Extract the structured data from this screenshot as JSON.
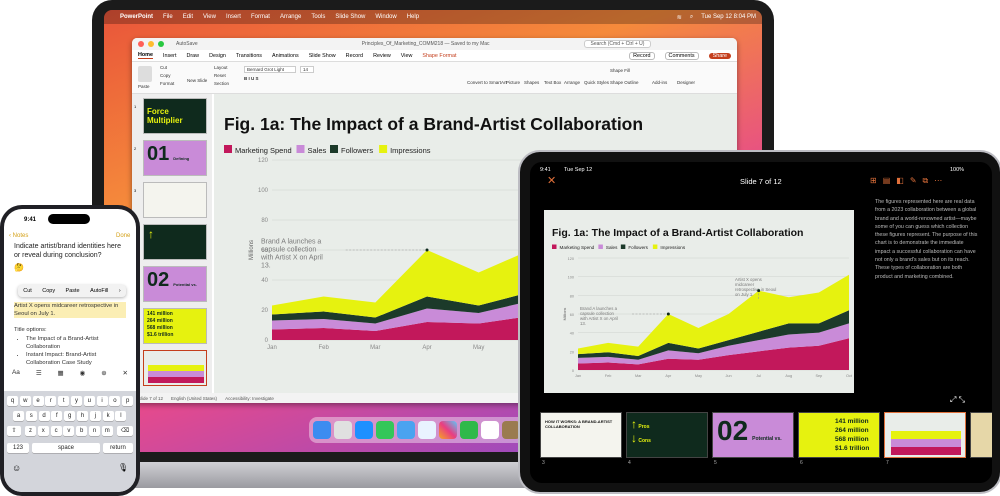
{
  "mac": {
    "menubar": {
      "apple": "",
      "app": "PowerPoint",
      "items": [
        "File",
        "Edit",
        "View",
        "Insert",
        "Format",
        "Arrange",
        "Tools",
        "Slide Show",
        "Window",
        "Help"
      ],
      "clock": "Tue Sep 12  8:04 PM"
    },
    "ppt": {
      "autosave": "AutoSave",
      "doc_title": "Principles_Of_Marketing_COMM218 — Saved to my Mac",
      "search": "Search (Cmd + Ctrl + U)",
      "tabs": [
        "Home",
        "Insert",
        "Draw",
        "Design",
        "Transitions",
        "Animations",
        "Slide Show",
        "Record",
        "Review",
        "View",
        "Shape Format"
      ],
      "record_btn": "Record",
      "comments_btn": "Comments",
      "share_btn": "Share",
      "ribbon": {
        "clip": [
          "Cut",
          "Copy",
          "Format"
        ],
        "paste": "Paste",
        "new_slide": "New Slide",
        "layout": "Layout",
        "reset": "Reset",
        "section": "Section",
        "font": "Bernard Grot Light",
        "size": "14",
        "convert": "Convert to SmartArt",
        "picture": "Picture",
        "shapes": "Shapes",
        "textbox": "Text Box",
        "arrange": "Arrange",
        "quick_styles": "Quick Styles",
        "shape_fill": "Shape Fill",
        "shape_outline": "Shape Outline",
        "addins": "Add-ins",
        "designer": "Designer"
      },
      "thumb_numbers": [
        "1",
        "2",
        "3",
        "4",
        "5",
        "6",
        "7"
      ],
      "thumbs": {
        "force": "Force Multiplier",
        "n01": "01",
        "n01_label": "Defining Collaboration",
        "n02": "02",
        "n02_label": "Potential vs. Impact",
        "stats": [
          "141 million",
          "264 million",
          "568 million",
          "$1.6 trillion"
        ]
      },
      "status": {
        "slide": "Slide 7 of 12",
        "lang": "English (United States)",
        "access": "Accessibility: Investigate"
      }
    }
  },
  "chart_data": {
    "type": "area",
    "title": "Fig. 1a: The Impact of a Brand-Artist Collaboration",
    "ylabel": "Millions",
    "xlabel": "",
    "categories": [
      "Jan",
      "Feb",
      "Mar",
      "Apr",
      "May",
      "Jun",
      "Jul",
      "Aug",
      "Sep",
      "Oct"
    ],
    "ylim": [
      0,
      120
    ],
    "yticks": [
      0,
      20,
      40,
      60,
      80,
      100,
      120
    ],
    "stacked": true,
    "series": [
      {
        "name": "Marketing Spend",
        "color": "#c2185b",
        "values": [
          7,
          8,
          6,
          12,
          11,
          16,
          20,
          24,
          26,
          34
        ]
      },
      {
        "name": "Sales",
        "color": "#c98bd8",
        "values": [
          6,
          6,
          5,
          9,
          7,
          10,
          12,
          14,
          14,
          16
        ]
      },
      {
        "name": "Followers",
        "color": "#1c3a2a",
        "values": [
          4,
          5,
          4,
          8,
          5,
          6,
          9,
          12,
          10,
          14
        ]
      },
      {
        "name": "Impressions",
        "color": "#e6f20f",
        "values": [
          6,
          10,
          10,
          31,
          22,
          28,
          44,
          28,
          33,
          38
        ]
      }
    ],
    "annotations": [
      {
        "text": "Brand A launches a capsule collection with Artist X on April 13.",
        "x": "Apr"
      },
      {
        "text": "Artist X opens midcareer retrospective in Seoul on July 1.",
        "x": "Jul"
      }
    ]
  },
  "ipad": {
    "clock": "9:41",
    "date": "Tue Sep 12",
    "title": "Slide 7 of 12",
    "battery": "100%",
    "notes": "The figures represented here are real data from a 2023 collaboration between a global brand and a world-renowned artist—maybe some of you can guess which collection these figures represent. The purpose of this chart is to demonstrate the immediate impact a successful collaboration can have not only a brand's sales but on its reach. These types of collaboration are both product and marketing combined.",
    "strip_numbers": [
      "3",
      "4",
      "5",
      "6",
      "7"
    ],
    "strip_headline": "HOW IT WORKS: A BRAND-ARTIST COLLABORATION",
    "strip_labels": [
      "Pros",
      "Cons"
    ]
  },
  "iphone": {
    "clock": "9:41",
    "back": "Notes",
    "done": "Done",
    "question": "Indicate artist/brand identities here or reveal during conclusion?",
    "emoji": "🤔",
    "edit_menu": [
      "Cut",
      "Copy",
      "Paste",
      "AutoFill"
    ],
    "selected_text": "Artist X opens midcareer retrospective in Seoul on July 1.",
    "title_options": "Title options:",
    "bullets": [
      "The Impact of a Brand-Artist Collaboration",
      "Instant Impact: Brand-Artist Collaboration Case Study"
    ],
    "toolbar": [
      "Aa",
      "☰",
      "▦",
      "◉",
      "⊕",
      "✕"
    ],
    "keys_row1": [
      "q",
      "w",
      "e",
      "r",
      "t",
      "y",
      "u",
      "i",
      "o",
      "p"
    ],
    "keys_row2": [
      "a",
      "s",
      "d",
      "f",
      "g",
      "h",
      "j",
      "k",
      "l"
    ],
    "keys_row3": [
      "z",
      "x",
      "c",
      "v",
      "b",
      "n",
      "m"
    ],
    "key_numbers": "123",
    "key_space": "space",
    "key_return": "return"
  }
}
